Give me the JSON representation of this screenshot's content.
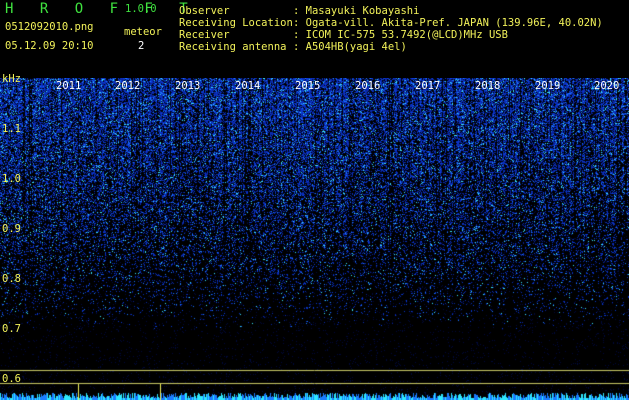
{
  "header": {
    "app_name": "H R O F F T",
    "version": "1.0.0",
    "filename": "0512092010.png",
    "mode": "meteor",
    "datetime": "05.12.09 20:10",
    "count": "2"
  },
  "info": {
    "observer_label": "Observer",
    "observer_value": ": Masayuki Kobayashi",
    "location_label": "Receiving Location",
    "location_value": ": Ogata-vill. Akita-Pref. JAPAN (139.96E, 40.02N)",
    "receiver_label": "Receiver",
    "receiver_value": ": ICOM IC-575 53.7492(@LCD)MHz USB",
    "antenna_label": "Receiving antenna",
    "antenna_value": ": A504HB(yagi 4el)"
  },
  "plot": {
    "y_unit": "kHz",
    "y_ticks": [
      "1.1",
      "1.0",
      "0.9",
      "0.8",
      "0.7",
      "0.6"
    ],
    "x_years": [
      "2011",
      "2012",
      "2013",
      "2014",
      "2015",
      "2016",
      "2017",
      "2018",
      "2019",
      "2020"
    ]
  },
  "colors": {
    "background": "#000000",
    "label_green": "#3fe23f",
    "label_yellow": "#f2f25a",
    "signal_blue": "#1a3cff",
    "signal_cyan": "#2fe8ff",
    "marker_line": "#c8c864"
  }
}
